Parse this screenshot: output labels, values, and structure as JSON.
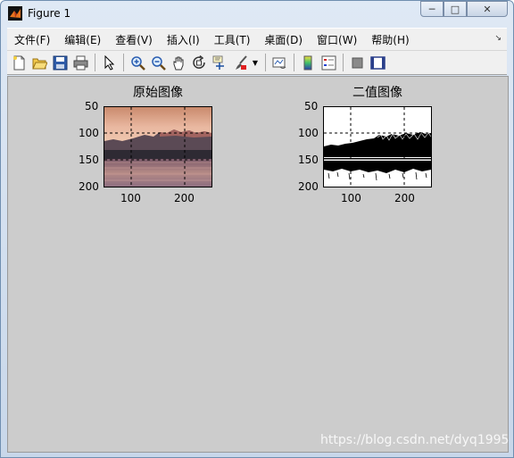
{
  "window": {
    "title": "Figure 1"
  },
  "menu": [
    "文件(F)",
    "编辑(E)",
    "查看(V)",
    "插入(I)",
    "工具(T)",
    "桌面(D)",
    "窗口(W)",
    "帮助(H)"
  ],
  "toolbar_icons": [
    "new-figure-icon",
    "open-file-icon",
    "save-icon",
    "print-icon",
    "pointer-icon",
    "zoom-in-icon",
    "zoom-out-icon",
    "pan-hand-icon",
    "rotate-3d-icon",
    "data-cursor-icon",
    "brush-icon",
    "brush-dropdown-icon",
    "link-plot-icon",
    "colorbar-icon",
    "legend-icon",
    "hide-plot-tools-icon",
    "show-plot-tools-icon"
  ],
  "plots": [
    {
      "title": "原始图像",
      "xticks": [
        "100",
        "200"
      ],
      "yticks": [
        "50",
        "100",
        "150",
        "200"
      ],
      "image_kind": "original-photo"
    },
    {
      "title": "二值图像",
      "xticks": [
        "100",
        "200"
      ],
      "yticks": [
        "50",
        "100",
        "150",
        "200"
      ],
      "image_kind": "binary-image"
    }
  ],
  "watermark": "https://blog.csdn.net/dyq1995"
}
